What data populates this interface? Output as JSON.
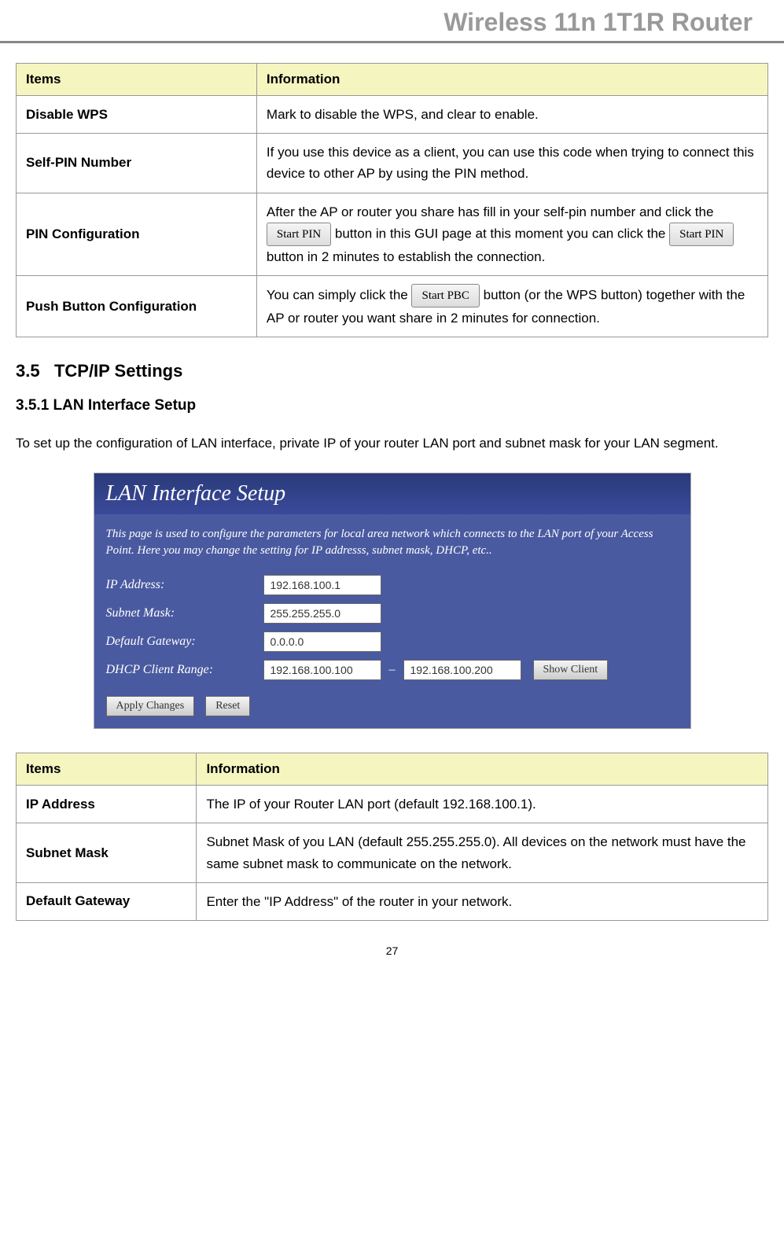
{
  "header": "Wireless 11n 1T1R Router",
  "table1": {
    "headers": [
      "Items",
      "Information"
    ],
    "rows": [
      {
        "item": "Disable WPS",
        "info": "Mark to disable the WPS, and clear to enable."
      },
      {
        "item": "Self-PIN Number",
        "info": "If you use this device as a client, you can use this code when trying to connect this device to other AP by using the PIN method."
      },
      {
        "item": "PIN Configuration",
        "info_parts": {
          "p1": "After the AP or router you share has fill in your self-pin number and click the ",
          "btn1": "Start PIN",
          "p2": " button in this GUI page at this moment you can click the ",
          "btn2": "Start PIN",
          "p3": " button in 2 minutes to establish the connection."
        }
      },
      {
        "item": "Push Button Configuration",
        "info_parts": {
          "p1": "You can simply click the ",
          "btn1": "Start PBC",
          "p2": " button (or the WPS button) together with the AP or router you want share in 2 minutes for connection."
        }
      }
    ]
  },
  "section": {
    "number": "3.5",
    "title": "TCP/IP Settings"
  },
  "subsection": {
    "number": "3.5.1",
    "title": "LAN Interface Setup"
  },
  "intro_text": "To set up the configuration of LAN interface, private IP of your router LAN port and subnet mask for your LAN segment.",
  "screenshot": {
    "title": "LAN Interface Setup",
    "description": "This page is used to configure the parameters for local area network which connects to the LAN port of your Access Point. Here you may change the setting for IP addresss, subnet mask, DHCP, etc..",
    "fields": {
      "ip_label": "IP Address:",
      "ip_value": "192.168.100.1",
      "subnet_label": "Subnet Mask:",
      "subnet_value": "255.255.255.0",
      "gateway_label": "Default Gateway:",
      "gateway_value": "0.0.0.0",
      "dhcp_label": "DHCP Client Range:",
      "dhcp_start": "192.168.100.100",
      "dhcp_end": "192.168.100.200",
      "show_client": "Show Client",
      "apply": "Apply Changes",
      "reset": "Reset"
    }
  },
  "table2": {
    "headers": [
      "Items",
      "Information"
    ],
    "rows": [
      {
        "item": "IP Address",
        "info": "The IP of your Router LAN port (default 192.168.100.1)."
      },
      {
        "item": "Subnet Mask",
        "info": "Subnet Mask of you LAN (default 255.255.255.0). All devices on the network must have the same subnet mask to communicate on the network."
      },
      {
        "item": "Default Gateway",
        "info": "Enter the \"IP Address\" of the router in your network."
      }
    ]
  },
  "page_number": "27"
}
